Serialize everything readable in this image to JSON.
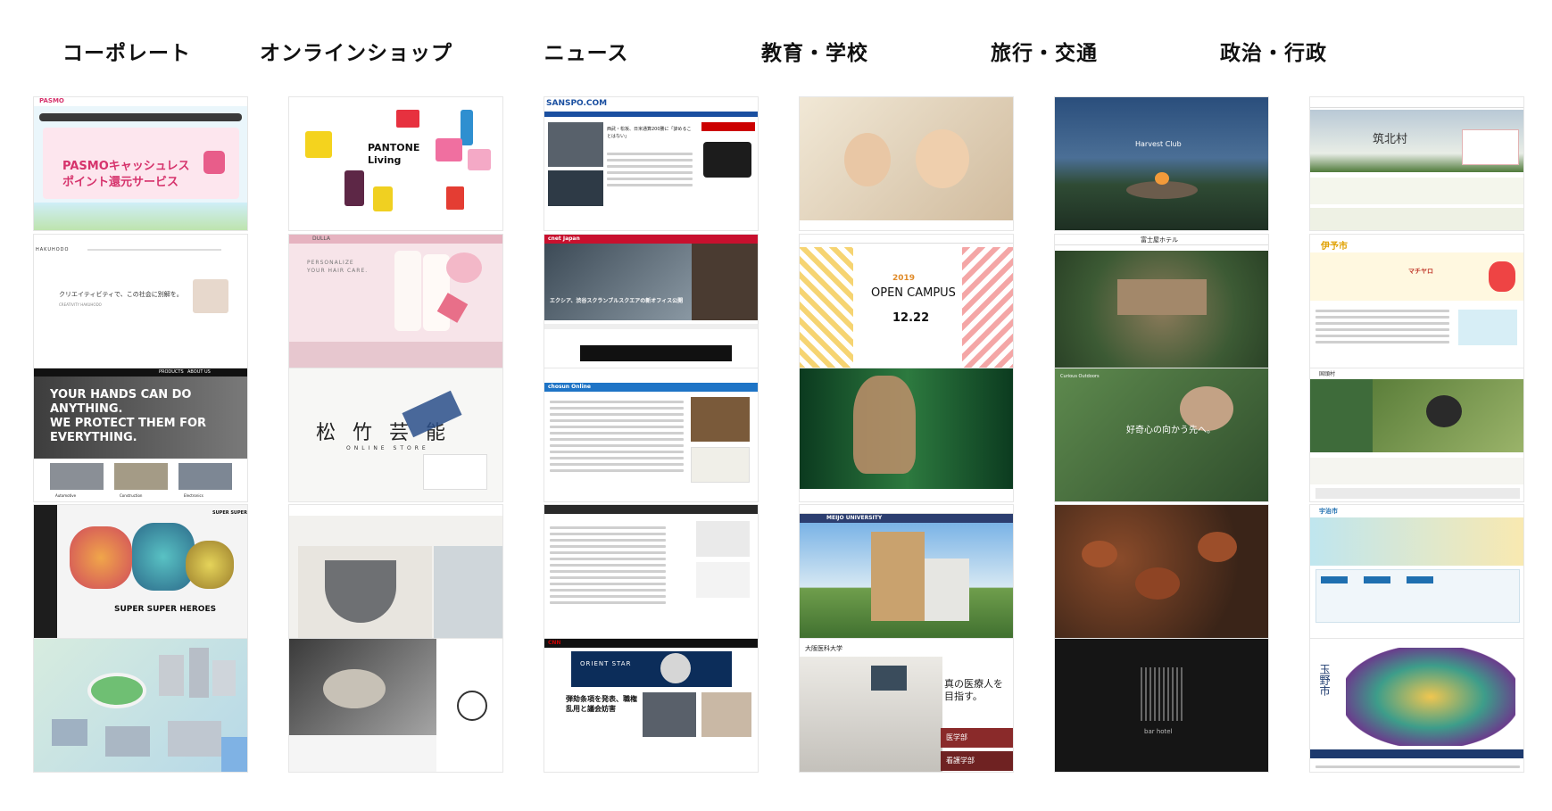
{
  "columns": [
    {
      "title": "コーポレート"
    },
    {
      "title": "オンラインショップ"
    },
    {
      "title": "ニュース"
    },
    {
      "title": "教育・学校"
    },
    {
      "title": "旅行・交通"
    },
    {
      "title": "政治・行政"
    }
  ],
  "corporate": {
    "pasmo": {
      "logo": "PASMO",
      "headline": "PASMOキャッシュレス",
      "headline2": "ポイント還元サービス"
    },
    "hakuhodo": {
      "logo": "HAKUHODO",
      "tagline": "クリエイティビティで、この社会に別解を。",
      "sub": "CREATIVITY HAKUHODO"
    },
    "shoei": {
      "line1": "YOUR HANDS CAN DO",
      "line2": "ANYTHING.",
      "line3": "WE PROTECT THEM FOR",
      "line4": "EVERYTHING.",
      "nav1": "PRODUCTS",
      "nav2": "ABOUT US",
      "cat1": "Automotive",
      "cat2": "Construction",
      "cat3": "Electronics"
    },
    "supersuper": {
      "logo": "SUPER SUPER",
      "title": "SUPER SUPER HEROES"
    }
  },
  "shop": {
    "pantone": {
      "brand": "PANTONE",
      "sub": "Living"
    },
    "dulla": {
      "brand": "DULLA",
      "copy1": "PERSONALIZE",
      "copy2": "YOUR HAIR CARE."
    },
    "shochiku": {
      "title": "松 竹 芸 能",
      "sub": "ONLINE STORE"
    }
  },
  "news": {
    "sanspo": {
      "logo": "SANSPO.COM",
      "headline": "西武・松坂、日米通算200勝に「諦めることはない」"
    },
    "cnet": {
      "logo": "cnet Japan",
      "headline": "エクシア、渋谷スクランブルスクエアの新オフィス公開"
    },
    "chosun": {
      "logo": "chosun Online"
    },
    "cnn": {
      "logo": "CNN",
      "ad": "ORIENT STAR",
      "headline": "弾劾条項を発表、職権乱用と議会妨害"
    }
  },
  "education": {
    "kyoto": {
      "title": "OPEN CAMPUS",
      "year": "2019",
      "date": "12.22"
    },
    "meijo": {
      "logo": "MEIJO UNIVERSITY"
    },
    "omc": {
      "logo": "大阪医科大学",
      "copy": "真の医療人を目指す。",
      "btn1": "医学部",
      "btn2": "看護学部"
    }
  },
  "travel": {
    "harvest": {
      "logo": "Harvest Club"
    },
    "fujiya": {
      "logo": "富士屋ホテル"
    },
    "curious": {
      "logo": "Curious Outdoors",
      "copy": "好奇心の向かう先へ。"
    },
    "barhotel": {
      "logo": "bar hotel"
    }
  },
  "gov": {
    "chikuhoku": {
      "name": "筑北村"
    },
    "iyo": {
      "name": "伊予市",
      "mascot": "マチヤロ"
    },
    "kunigami": {
      "name": "国頭村"
    },
    "uji": {
      "name": "宇治市"
    },
    "tamano": {
      "name": "玉野市"
    }
  }
}
